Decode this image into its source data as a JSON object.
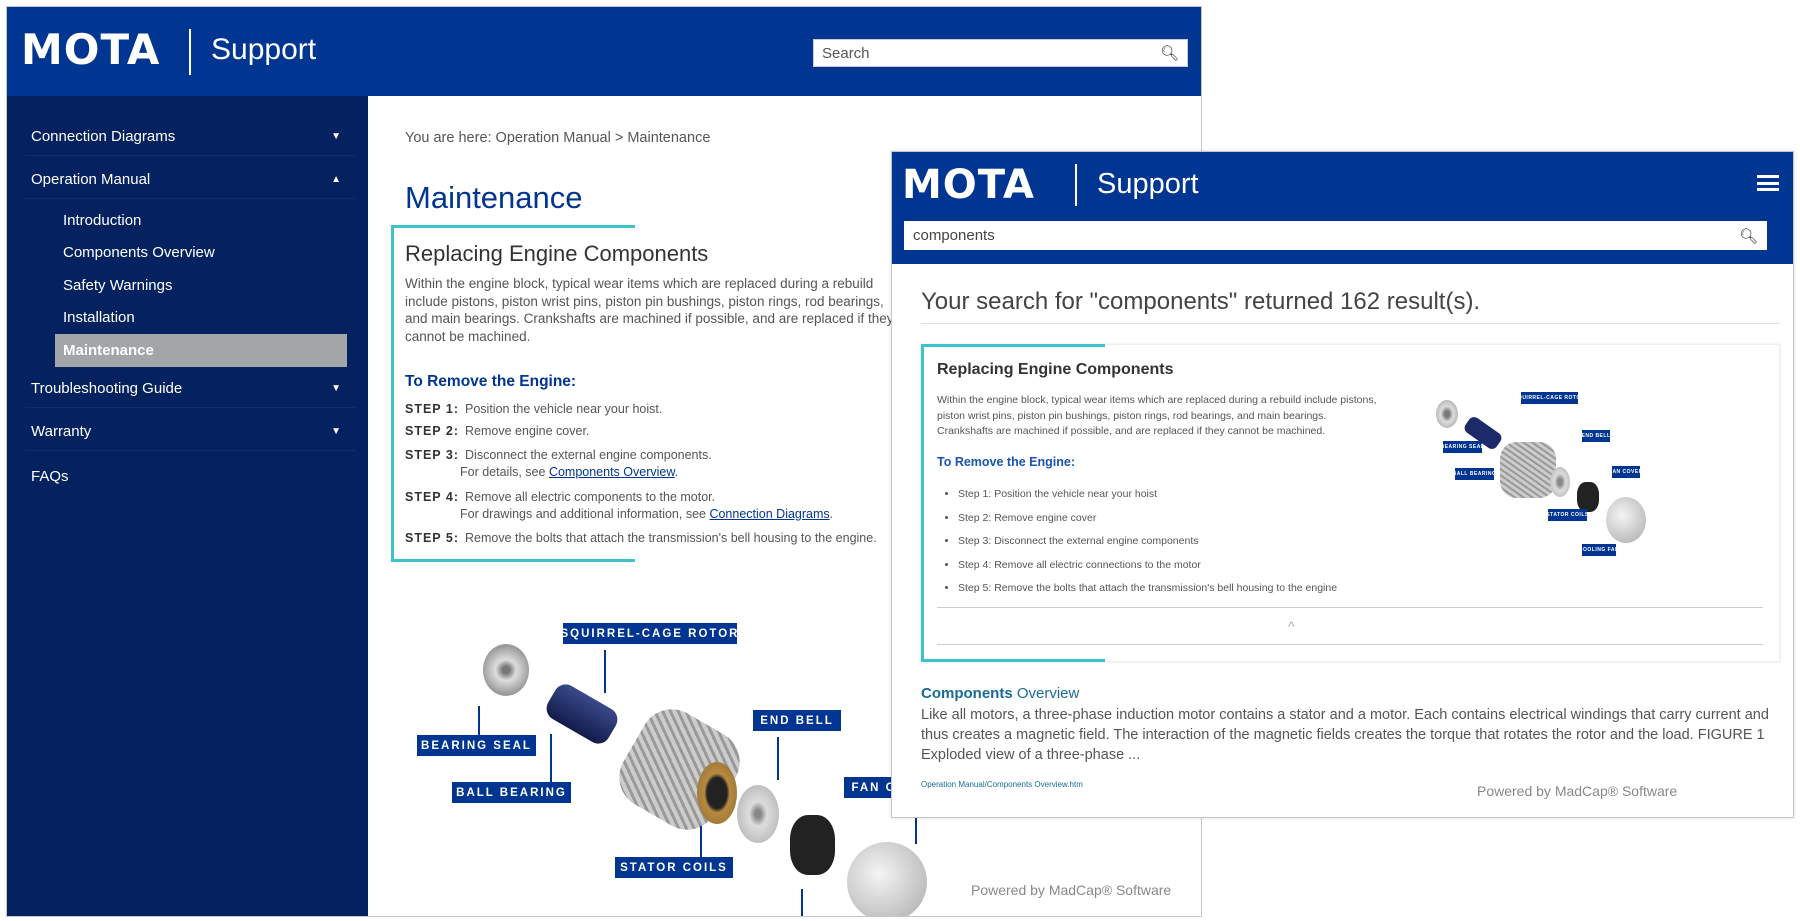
{
  "left_window": {
    "logo": "MOTA",
    "support": "Support",
    "search_placeholder": "Search",
    "sidebar": {
      "items": [
        {
          "label": "Connection Diagrams",
          "caret": "▼"
        },
        {
          "label": "Operation Manual",
          "caret": "▲"
        },
        {
          "label": "Troubleshooting Guide",
          "caret": "▼"
        },
        {
          "label": "Warranty",
          "caret": "▼"
        },
        {
          "label": "FAQs"
        }
      ],
      "subitems": [
        "Introduction",
        "Components Overview",
        "Safety Warnings",
        "Installation",
        "Maintenance"
      ],
      "selected": "Maintenance"
    },
    "breadcrumb": "You are here: Operation Manual > Maintenance",
    "title": "Maintenance",
    "section_title": "Replacing Engine Components",
    "section_text": "Within the engine block, typical wear items which are replaced during a rebuild include pistons, piston wrist pins, piston pin bushings, piston rings, rod bearings, and main bearings. Crankshafts are machined if possible, and are replaced if they cannot be machined.",
    "steps_heading": "To Remove the Engine:",
    "steps": [
      {
        "label": "STEP 1:",
        "text": "Position the vehicle near your hoist."
      },
      {
        "label": "STEP 2:",
        "text": "Remove engine cover."
      },
      {
        "label": "STEP 3:",
        "text": "Disconnect the external engine components.",
        "note": "For details, see ",
        "link": "Components Overview",
        "end": "."
      },
      {
        "label": "STEP 4:",
        "text": "Remove all electric  components to the motor.",
        "note": "For drawings and additional information, see ",
        "link": "Connection Diagrams",
        "end": "."
      },
      {
        "label": "STEP 5:",
        "text": "Remove the bolts that attach the transmission's bell housing to the engine."
      }
    ],
    "diagram_labels": [
      "SQUIRREL-CAGE ROTOR",
      "BEARING SEAL",
      "BALL BEARING",
      "END BELL",
      "STATOR COILS",
      "FAN COVER"
    ],
    "footer": "Powered by MadCap® Software"
  },
  "right_window": {
    "logo": "MOTA",
    "support": "Support",
    "menu_icon": "hamburger-icon",
    "search_value": "components",
    "results_heading": "Your search for \"components\" returned 162 result(s).",
    "card": {
      "title": "Replacing Engine Components",
      "text": "Within the engine block, typical wear items which are replaced during a rebuild include pistons, piston wrist pins, piston pin bushings, piston rings, rod bearings, and main bearings. Crankshafts are machined if possible, and are replaced if they cannot be machined.",
      "steps_heading": "To Remove the Engine:",
      "steps": [
        "Step 1: Position the vehicle near your hoist",
        "Step 2: Remove engine cover",
        "Step 3: Disconnect the external engine components",
        "Step 4: Remove all electric connections to the motor",
        "Step 5: Remove the bolts that attach the transmission's bell housing to the engine"
      ],
      "diagram_labels": [
        "SQUIRREL-CAGE ROTOR",
        "BEARING SEAL",
        "BALL BEARING",
        "END BELL",
        "FAN COVER",
        "STATOR COILS",
        "COOLING FAN"
      ],
      "collapse": "^"
    },
    "result2": {
      "title_bold": "Components",
      "title_rest": " Overview",
      "text": "Like all motors, a three-phase induction motor contains a stator and a motor. Each contains electrical windings that carry current and thus creates a magnetic field. The interaction of the magnetic fields creates the torque that rotates the rotor and the load. FIGURE 1 Exploded view of a three-phase ...",
      "url": "Operation Manual/Components Overview.htm"
    },
    "footer": "Powered by MadCap® Software"
  },
  "colors": {
    "brand": "#003591",
    "sidebar": "#04225f",
    "accent": "#3cc3cc"
  }
}
